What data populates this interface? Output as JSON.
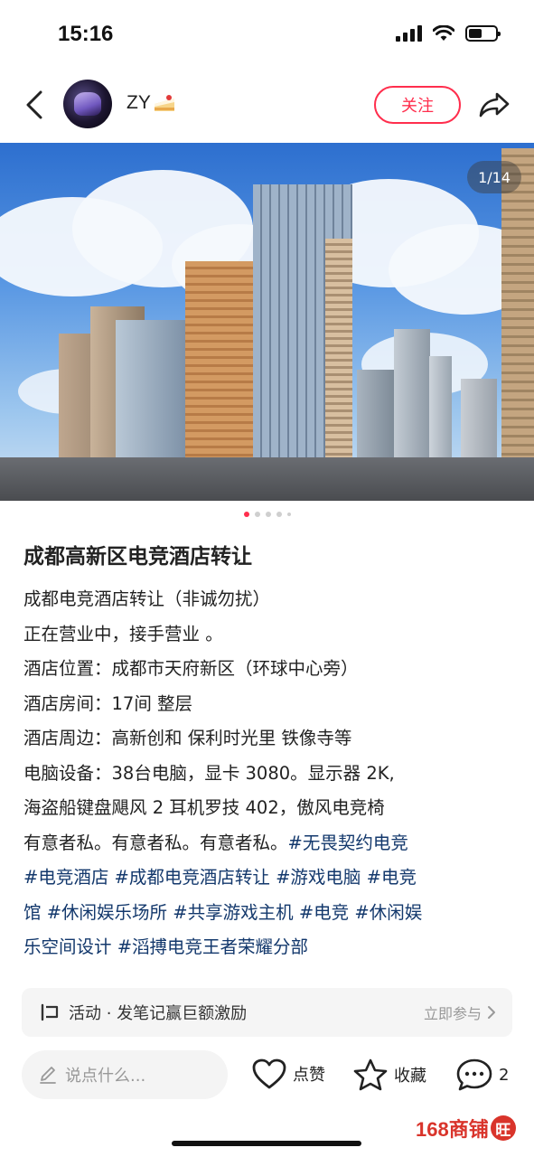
{
  "status_bar": {
    "time": "15:16"
  },
  "header": {
    "username": "ZY",
    "follow_label": "关注"
  },
  "photo": {
    "counter": "1/14",
    "dot_count": 5,
    "active_dot": 0
  },
  "post": {
    "title": "成都高新区电竞酒店转让",
    "lines": [
      "成都电竞酒店转让（非诚勿扰）",
      "正在营业中，接手营业 。",
      "酒店位置：成都市天府新区（环球中心旁）",
      "酒店房间：17间 整层",
      "酒店周边：高新创和 保利时光里 铁像寺等",
      "电脑设备：38台电脑，显卡 3080。显示器 2K,",
      "海盗船键盘飓风 2 耳机罗技 402，傲风电竞椅"
    ],
    "line8_text": "有意者私。有意者私。有意者私。",
    "tags": [
      "#无畏契约电竞",
      "#电竞酒店",
      "#成都电竞酒店转让",
      "#游戏电脑",
      "#电竞",
      "馆",
      "#休闲娱乐场所",
      "#共享游戏主机",
      "#电竞",
      "#休闲娱",
      "乐空间设计",
      "#滔搏电竞王者荣耀分部"
    ]
  },
  "activity": {
    "text": "活动 · 发笔记赢巨额激励",
    "cta": "立即参与"
  },
  "bottom_bar": {
    "comment_placeholder": "说点什么...",
    "like_label": "点赞",
    "collect_label": "收藏",
    "comment_count": "2"
  },
  "watermark": {
    "text": "168商铺",
    "badge": "旺"
  },
  "colors": {
    "accent": "#ff2e4d",
    "tag": "#13386c"
  }
}
